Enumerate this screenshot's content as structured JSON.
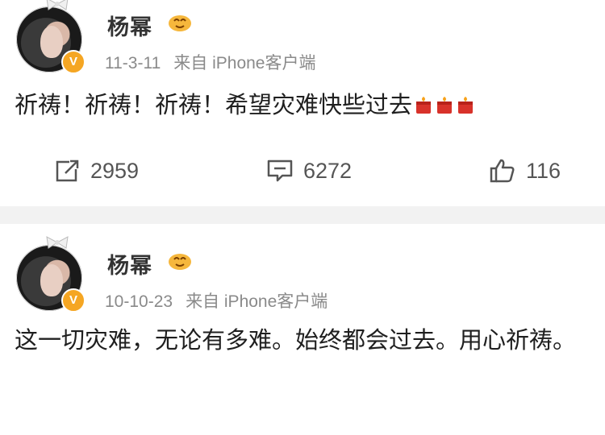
{
  "posts": [
    {
      "author": "杨幂",
      "date": "11-3-11",
      "source": "来自 iPhone客户端",
      "content": "祈祷！祈祷！祈祷！希望灾难快些过去",
      "emoji_after_content": [
        "candle-icon",
        "candle-icon",
        "candle-icon"
      ],
      "actions": {
        "repost": {
          "icon": "repost-icon",
          "count": "2959"
        },
        "comment": {
          "icon": "comment-icon",
          "count": "6272"
        },
        "like": {
          "icon": "thumbs-up-icon",
          "count": "116"
        }
      }
    },
    {
      "author": "杨幂",
      "date": "10-10-23",
      "source": "来自 iPhone客户端",
      "content": "这一切灾难，无论有多难。始终都会过去。用心祈祷。"
    }
  ],
  "colors": {
    "badge": "#f5a623",
    "separator": "#f2f2f2",
    "meta_text": "#8a8a8a"
  }
}
